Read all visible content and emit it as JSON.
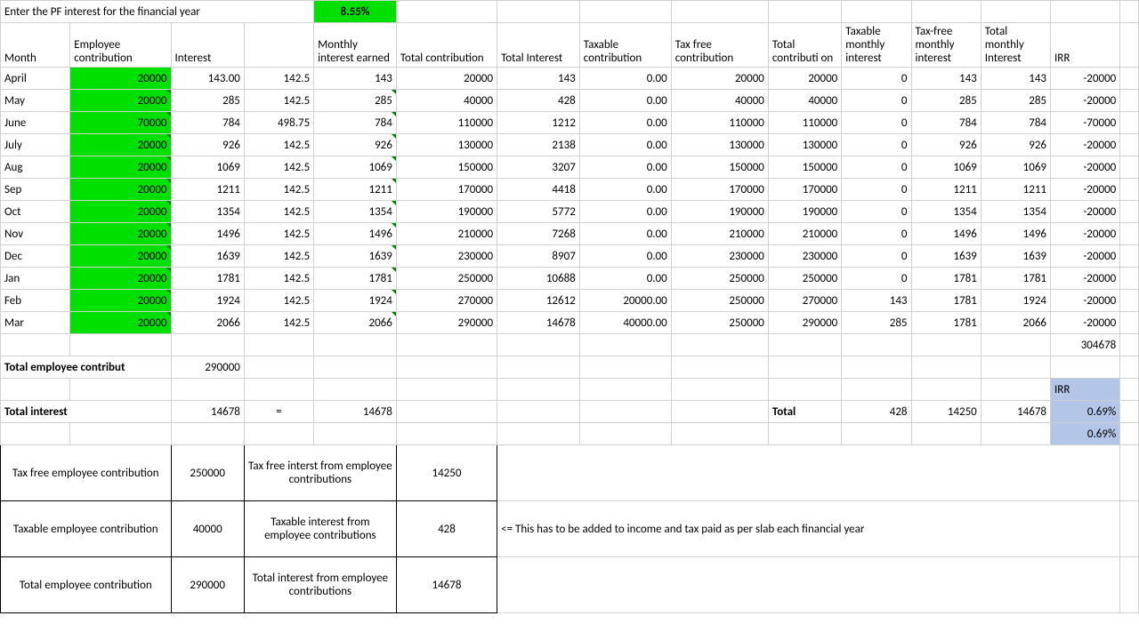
{
  "topLabel": "Enter the PF interest for the financial year",
  "pfRate": "8.55%",
  "headers": {
    "month": "Month",
    "empContrib": "Employee contribution",
    "interest": "Interest",
    "colD": "",
    "monthlyInterest": "Monthly interest earned",
    "totalContrib": "Total contribution",
    "totalInterest": "Total Interest",
    "taxableContrib": "Taxable contribution",
    "taxFreeContrib": "Tax free contribution",
    "totalContrib2": "Total contributi on",
    "taxableMonthly": "Taxable monthly interest",
    "taxFreeMonthly": "Tax-free monthly interest",
    "totalMonthly": "Total monthly Interest",
    "irr": "IRR"
  },
  "rows": [
    {
      "m": "April",
      "ec": "20000",
      "int": "143.00",
      "d": "142.5",
      "mie": "143",
      "tc": "20000",
      "ti": "143",
      "txc": "0.00",
      "tfc": "20000",
      "tc2": "20000",
      "tmi": "0",
      "tfmi": "143",
      "tmi2": "143",
      "irr": "-20000"
    },
    {
      "m": "May",
      "ec": "20000",
      "int": "285",
      "d": "142.5",
      "mie": "285",
      "tc": "40000",
      "ti": "428",
      "txc": "0.00",
      "tfc": "40000",
      "tc2": "40000",
      "tmi": "0",
      "tfmi": "285",
      "tmi2": "285",
      "irr": "-20000"
    },
    {
      "m": "June",
      "ec": "70000",
      "int": "784",
      "d": "498.75",
      "mie": "784",
      "tc": "110000",
      "ti": "1212",
      "txc": "0.00",
      "tfc": "110000",
      "tc2": "110000",
      "tmi": "0",
      "tfmi": "784",
      "tmi2": "784",
      "irr": "-70000"
    },
    {
      "m": "July",
      "ec": "20000",
      "int": "926",
      "d": "142.5",
      "mie": "926",
      "tc": "130000",
      "ti": "2138",
      "txc": "0.00",
      "tfc": "130000",
      "tc2": "130000",
      "tmi": "0",
      "tfmi": "926",
      "tmi2": "926",
      "irr": "-20000"
    },
    {
      "m": "Aug",
      "ec": "20000",
      "int": "1069",
      "d": "142.5",
      "mie": "1069",
      "tc": "150000",
      "ti": "3207",
      "txc": "0.00",
      "tfc": "150000",
      "tc2": "150000",
      "tmi": "0",
      "tfmi": "1069",
      "tmi2": "1069",
      "irr": "-20000"
    },
    {
      "m": "Sep",
      "ec": "20000",
      "int": "1211",
      "d": "142.5",
      "mie": "1211",
      "tc": "170000",
      "ti": "4418",
      "txc": "0.00",
      "tfc": "170000",
      "tc2": "170000",
      "tmi": "0",
      "tfmi": "1211",
      "tmi2": "1211",
      "irr": "-20000"
    },
    {
      "m": "Oct",
      "ec": "20000",
      "int": "1354",
      "d": "142.5",
      "mie": "1354",
      "tc": "190000",
      "ti": "5772",
      "txc": "0.00",
      "tfc": "190000",
      "tc2": "190000",
      "tmi": "0",
      "tfmi": "1354",
      "tmi2": "1354",
      "irr": "-20000"
    },
    {
      "m": "Nov",
      "ec": "20000",
      "int": "1496",
      "d": "142.5",
      "mie": "1496",
      "tc": "210000",
      "ti": "7268",
      "txc": "0.00",
      "tfc": "210000",
      "tc2": "210000",
      "tmi": "0",
      "tfmi": "1496",
      "tmi2": "1496",
      "irr": "-20000"
    },
    {
      "m": "Dec",
      "ec": "20000",
      "int": "1639",
      "d": "142.5",
      "mie": "1639",
      "tc": "230000",
      "ti": "8907",
      "txc": "0.00",
      "tfc": "230000",
      "tc2": "230000",
      "tmi": "0",
      "tfmi": "1639",
      "tmi2": "1639",
      "irr": "-20000"
    },
    {
      "m": "Jan",
      "ec": "20000",
      "int": "1781",
      "d": "142.5",
      "mie": "1781",
      "tc": "250000",
      "ti": "10688",
      "txc": "0.00",
      "tfc": "250000",
      "tc2": "250000",
      "tmi": "0",
      "tfmi": "1781",
      "tmi2": "1781",
      "irr": "-20000"
    },
    {
      "m": "Feb",
      "ec": "20000",
      "int": "1924",
      "d": "142.5",
      "mie": "1924",
      "tc": "270000",
      "ti": "12612",
      "txc": "20000.00",
      "tfc": "250000",
      "tc2": "270000",
      "tmi": "143",
      "tfmi": "1781",
      "tmi2": "1924",
      "irr": "-20000"
    },
    {
      "m": "Mar",
      "ec": "20000",
      "int": "2066",
      "d": "142.5",
      "mie": "2066",
      "tc": "290000",
      "ti": "14678",
      "txc": "40000.00",
      "tfc": "250000",
      "tc2": "290000",
      "tmi": "285",
      "tfmi": "1781",
      "tmi2": "2066",
      "irr": "-20000"
    }
  ],
  "lastIrr": "304678",
  "totalEmpLabel": "Total employee contribut",
  "totalEmpVal": "290000",
  "totalInterestLabel": "Total interest",
  "totalInterestVal1": "14678",
  "eq": "=",
  "totalInterestVal2": "14678",
  "totalWord": "Total",
  "totTaxable": "428",
  "totTaxFree": "14250",
  "totMonthly": "14678",
  "irrLabel": "IRR",
  "irrPct1": "0.69%",
  "irrPct2": "0.69%",
  "summary": {
    "r1c1": "Tax free employee contribution",
    "r1c2": "250000",
    "r1c3": "Tax free interst from employee contributions",
    "r1c4": "14250",
    "r2c1": "Taxable employee contribution",
    "r2c2": "40000",
    "r2c3": "Taxable interest from employee contributions",
    "r2c4": "428",
    "r2note": "<= This has to be added to income and tax paid as per slab each financial year",
    "r3c1": "Total employee contribution",
    "r3c2": "290000",
    "r3c3": "Total interest from employee contributions",
    "r3c4": "14678"
  },
  "chart_data": {
    "type": "table",
    "title": "PF Interest Calculation",
    "categories": [
      "April",
      "May",
      "June",
      "July",
      "Aug",
      "Sep",
      "Oct",
      "Nov",
      "Dec",
      "Jan",
      "Feb",
      "Mar"
    ],
    "series": [
      {
        "name": "Employee contribution",
        "values": [
          20000,
          20000,
          70000,
          20000,
          20000,
          20000,
          20000,
          20000,
          20000,
          20000,
          20000,
          20000
        ]
      },
      {
        "name": "Interest",
        "values": [
          143,
          285,
          784,
          926,
          1069,
          1211,
          1354,
          1496,
          1639,
          1781,
          1924,
          2066
        ]
      },
      {
        "name": "Monthly interest earned",
        "values": [
          143,
          285,
          784,
          926,
          1069,
          1211,
          1354,
          1496,
          1639,
          1781,
          1924,
          2066
        ]
      },
      {
        "name": "Total contribution",
        "values": [
          20000,
          40000,
          110000,
          130000,
          150000,
          170000,
          190000,
          210000,
          230000,
          250000,
          270000,
          290000
        ]
      },
      {
        "name": "Total Interest",
        "values": [
          143,
          428,
          1212,
          2138,
          3207,
          4418,
          5772,
          7268,
          8907,
          10688,
          12612,
          14678
        ]
      },
      {
        "name": "Taxable contribution",
        "values": [
          0,
          0,
          0,
          0,
          0,
          0,
          0,
          0,
          0,
          0,
          20000,
          40000
        ]
      },
      {
        "name": "Tax free contribution",
        "values": [
          20000,
          40000,
          110000,
          130000,
          150000,
          170000,
          190000,
          210000,
          230000,
          250000,
          250000,
          250000
        ]
      },
      {
        "name": "Taxable monthly interest",
        "values": [
          0,
          0,
          0,
          0,
          0,
          0,
          0,
          0,
          0,
          0,
          143,
          285
        ]
      },
      {
        "name": "Tax-free monthly interest",
        "values": [
          143,
          285,
          784,
          926,
          1069,
          1211,
          1354,
          1496,
          1639,
          1781,
          1781,
          1781
        ]
      },
      {
        "name": "Total monthly Interest",
        "values": [
          143,
          285,
          784,
          926,
          1069,
          1211,
          1354,
          1496,
          1639,
          1781,
          1924,
          2066
        ]
      },
      {
        "name": "IRR",
        "values": [
          -20000,
          -20000,
          -70000,
          -20000,
          -20000,
          -20000,
          -20000,
          -20000,
          -20000,
          -20000,
          -20000,
          -20000
        ]
      }
    ]
  }
}
